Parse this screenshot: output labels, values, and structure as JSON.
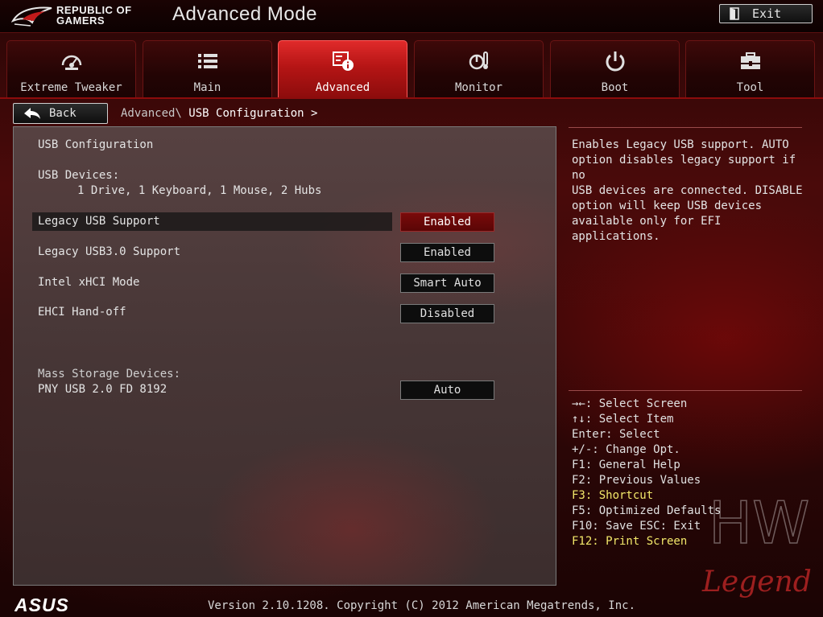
{
  "header": {
    "brand_line1": "REPUBLIC OF",
    "brand_line2": "GAMERS",
    "mode_title": "Advanced Mode",
    "exit_label": "Exit"
  },
  "tabs": [
    {
      "label": "Extreme Tweaker",
      "icon": "dial-gauge-icon",
      "active": false
    },
    {
      "label": "Main",
      "icon": "list-icon",
      "active": false
    },
    {
      "label": "Advanced",
      "icon": "advanced-settings-icon",
      "active": true
    },
    {
      "label": "Monitor",
      "icon": "thermometer-fan-icon",
      "active": false
    },
    {
      "label": "Boot",
      "icon": "power-icon",
      "active": false
    },
    {
      "label": "Tool",
      "icon": "toolbox-icon",
      "active": false
    }
  ],
  "nav": {
    "back_label": "Back",
    "breadcrumb_parent": "Advanced\\",
    "breadcrumb_current": "USB Configuration >"
  },
  "main": {
    "section_title": "USB Configuration",
    "usb_devices_label": "USB Devices:",
    "usb_devices_value": "1 Drive, 1 Keyboard, 1 Mouse, 2 Hubs",
    "settings": [
      {
        "label": "Legacy USB Support",
        "value": "Enabled",
        "selected": true
      },
      {
        "label": "Legacy USB3.0 Support",
        "value": "Enabled",
        "selected": false
      },
      {
        "label": "Intel xHCI Mode",
        "value": "Smart Auto",
        "selected": false
      },
      {
        "label": "EHCI Hand-off",
        "value": "Disabled",
        "selected": false
      }
    ],
    "mass_storage_label": "Mass Storage Devices:",
    "mass_storage_device": "PNY USB 2.0 FD 8192",
    "mass_storage_value": "Auto"
  },
  "help": {
    "lines": [
      "Enables Legacy USB support. AUTO",
      "option disables legacy support if no",
      "USB devices are connected. DISABLE",
      "option will keep USB devices",
      "available only for EFI applications."
    ]
  },
  "keys": [
    {
      "text": "→←: Select Screen",
      "highlight": false
    },
    {
      "text": "↑↓: Select Item",
      "highlight": false
    },
    {
      "text": "Enter: Select",
      "highlight": false
    },
    {
      "text": "+/-: Change Opt.",
      "highlight": false
    },
    {
      "text": "F1: General Help",
      "highlight": false
    },
    {
      "text": "F2: Previous Values",
      "highlight": false
    },
    {
      "text": "F3: Shortcut",
      "highlight": true
    },
    {
      "text": "F5: Optimized Defaults",
      "highlight": false
    },
    {
      "text": "F10: Save  ESC: Exit",
      "highlight": false
    },
    {
      "text": "F12: Print Screen",
      "highlight": true
    }
  ],
  "watermark": {
    "line1": "HW",
    "line2": "Legend"
  },
  "footer": {
    "logo_text": "ASUS",
    "version": "Version 2.10.1208. Copyright (C) 2012 American Megatrends, Inc."
  },
  "colors": {
    "accent_red": "#b51515",
    "highlight_yellow": "#f3e86a",
    "selected_value_bg": "#7a0a0a"
  }
}
